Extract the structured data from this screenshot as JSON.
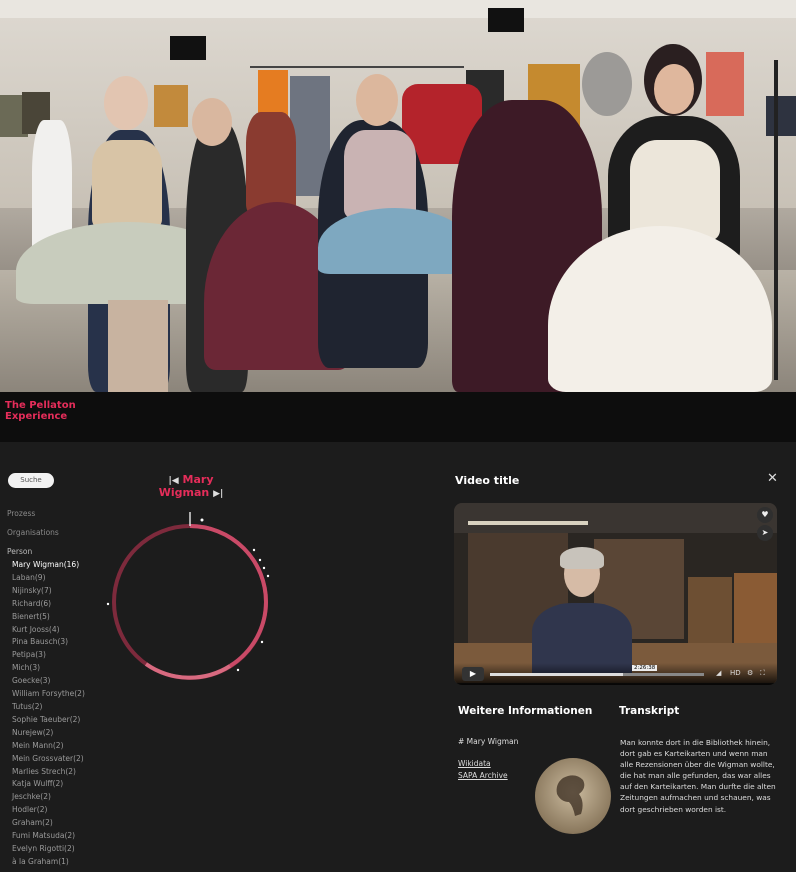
{
  "brand": {
    "line1": "The Pellaton",
    "line2": "Experience",
    "color": "#e52d5a"
  },
  "search": {
    "label": "Suche"
  },
  "categories": {
    "prozess": "Prozess",
    "organisations": "Organisations",
    "person": "Person"
  },
  "persons": [
    "Mary Wigman(16)",
    "Laban(9)",
    "Nijinsky(7)",
    "Richard(6)",
    "Bienert(5)",
    "Kurt Jooss(4)",
    "Pina Bausch(3)",
    "Petipa(3)",
    "Mich(3)",
    "Goecke(3)",
    "William Forsythe(2)",
    "Tutus(2)",
    "Sophie Taeuber(2)",
    "Nurejew(2)",
    "Mein Mann(2)",
    "Mein Grossvater(2)",
    "Marlies Strech(2)",
    "Katja Wulff(2)",
    "Jeschke(2)",
    "Hodler(2)",
    "Graham(2)",
    "Fumi Matsuda(2)",
    "Evelyn Rigotti(2)",
    "à la Graham(1)"
  ],
  "wheel": {
    "title": "Mary Wigman",
    "prev_icon": "skip-back-icon",
    "next_icon": "skip-forward-icon"
  },
  "video": {
    "title": "Video title",
    "close_icon": "close-icon",
    "time": "2:26:38",
    "progress": 0.62
  },
  "info": {
    "heading": "Weitere Informationen",
    "tag": "# Mary Wigman",
    "links": [
      "Wikidata",
      "SAPA Archive"
    ]
  },
  "transcript": {
    "heading": "Transkript",
    "text": "Man konnte dort in die Bibliothek hinein, dort gab es Karteikarten und wenn man alle Rezensionen über die Wigman wollte, die hat man alle gefunden, das war alles auf den Karteikarten. Man durfte die alten Zeitungen aufmachen und schauen, was dort geschrieben worden ist."
  }
}
